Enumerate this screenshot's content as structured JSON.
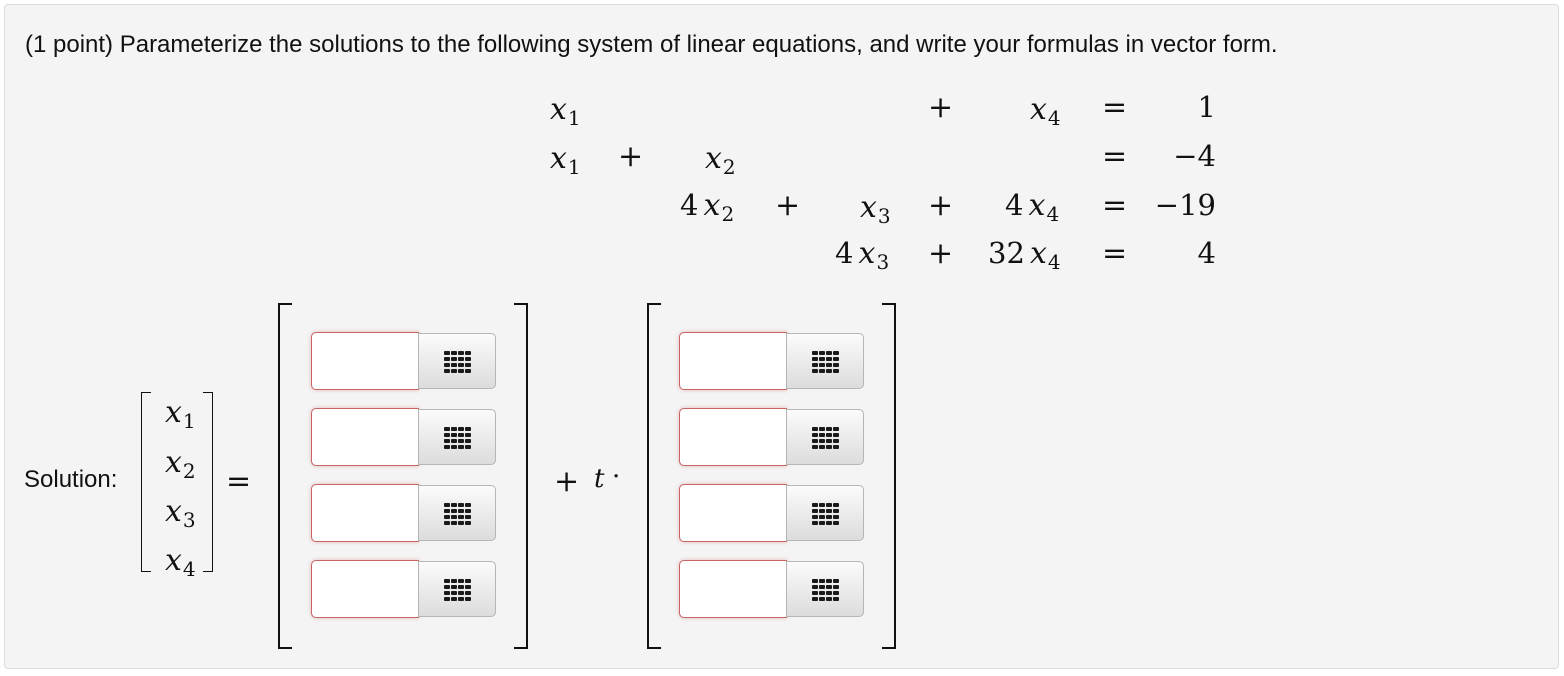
{
  "prompt": "(1 point) Parameterize the solutions to the following system of linear equations, and write your formulas in vector form.",
  "system": {
    "r1": {
      "x1": "x",
      "x1s": "1",
      "p3": "+",
      "x4": "x",
      "x4s": "4",
      "eq": "=",
      "rhs": "1"
    },
    "r2": {
      "x1": "x",
      "x1s": "1",
      "p1": "+",
      "x2": "x",
      "x2s": "2",
      "eq": "=",
      "rhs": "−4"
    },
    "r3": {
      "c2": "4",
      "x2": "x",
      "x2s": "2",
      "p2": "+",
      "x3": "x",
      "x3s": "3",
      "p3": "+",
      "c4": "4",
      "x4": "x",
      "x4s": "4",
      "eq": "=",
      "rhs": "−19"
    },
    "r4": {
      "c3": "4",
      "x3": "x",
      "x3s": "3",
      "p3": "+",
      "c4": "32",
      "x4": "x",
      "x4s": "4",
      "eq": "=",
      "rhs": "4"
    }
  },
  "solution": {
    "label": "Solution:",
    "vars": [
      {
        "v": "x",
        "s": "1"
      },
      {
        "v": "x",
        "s": "2"
      },
      {
        "v": "x",
        "s": "3"
      },
      {
        "v": "x",
        "s": "4"
      }
    ],
    "equals": "=",
    "plus": "+",
    "param": "t",
    "dot": "·",
    "vector1": [
      "",
      "",
      "",
      ""
    ],
    "vector2": [
      "",
      "",
      "",
      ""
    ]
  },
  "icons": {
    "palette": "grid-palette-icon"
  },
  "colors": {
    "input_border": "#c86464",
    "panel_bg": "#f4f4f4"
  }
}
